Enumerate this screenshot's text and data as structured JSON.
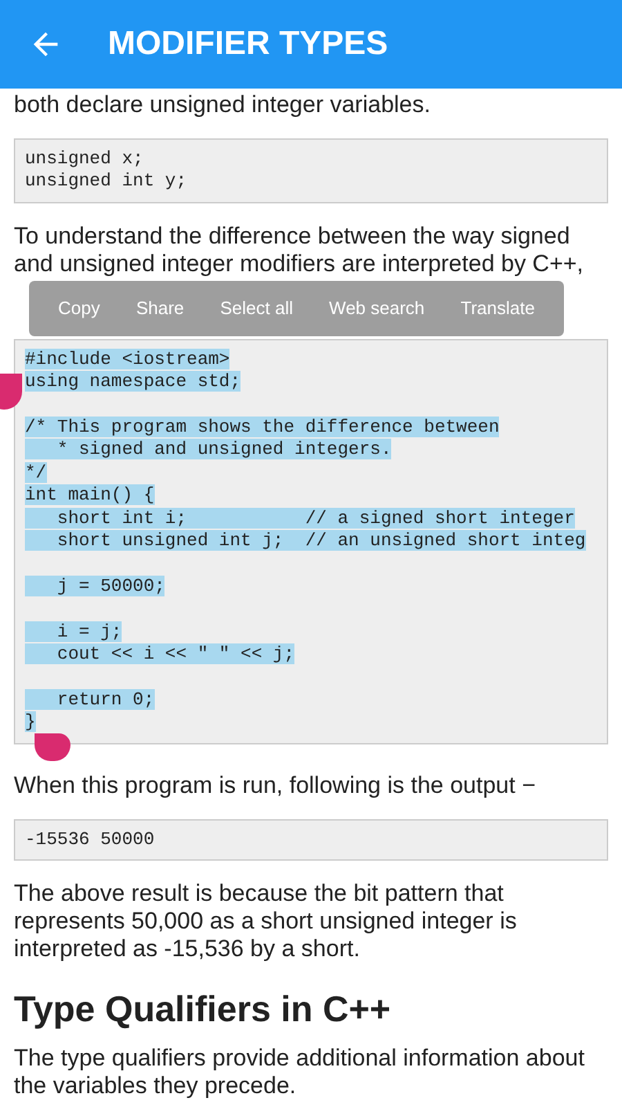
{
  "app_bar": {
    "title": "MODIFIER TYPES"
  },
  "content": [
    {
      "kind": "paragraph",
      "text": "both declare unsigned integer variables."
    },
    {
      "kind": "code",
      "text": "unsigned x;\nunsigned int y;",
      "selected": false
    },
    {
      "kind": "paragraph",
      "text": "To understand the difference between the way signed and unsigned integer modifiers are interpreted by C++,"
    },
    {
      "kind": "code",
      "text": "#include <iostream>\nusing namespace std;\n\n/* This program shows the difference between\n   * signed and unsigned integers.\n*/\nint main() {\n   short int i;           // a signed short integer\n   short unsigned int j;  // an unsigned short integ\n\n   j = 50000;\n\n   i = j;\n   cout << i << \" \" << j;\n\n   return 0;\n}",
      "selected": true
    },
    {
      "kind": "paragraph",
      "text": "When this program is run, following is the output −"
    },
    {
      "kind": "code",
      "text": "-15536 50000",
      "selected": false
    },
    {
      "kind": "paragraph",
      "text": "The above result is because the bit pattern that represents 50,000 as a short unsigned integer is interpreted as -15,536 by a short."
    },
    {
      "kind": "heading",
      "text": "Type Qualifiers in C++"
    },
    {
      "kind": "paragraph",
      "text": "The type qualifiers provide additional information about the variables they precede."
    }
  ],
  "context_menu": [
    "Copy",
    "Share",
    "Select all",
    "Web search",
    "Translate"
  ]
}
